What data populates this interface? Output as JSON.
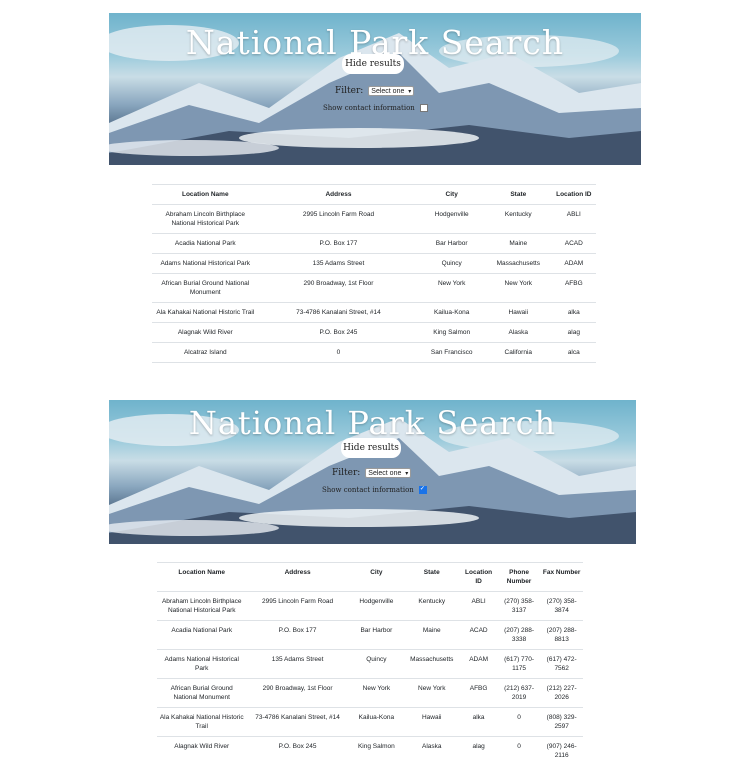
{
  "app": {
    "title": "National Park Search",
    "hide_button": "Hide results",
    "filter_label": "Filter:",
    "filter_selected": "Select one",
    "contact_label": "Show contact information"
  },
  "view1": {
    "contact_checked": false,
    "columns": [
      "Location Name",
      "Address",
      "City",
      "State",
      "Location ID"
    ],
    "rows": [
      [
        "Abraham Lincoln Birthplace National Historical Park",
        "2995 Lincoln Farm Road",
        "Hodgenville",
        "Kentucky",
        "ABLI"
      ],
      [
        "Acadia National Park",
        "P.O. Box 177",
        "Bar Harbor",
        "Maine",
        "ACAD"
      ],
      [
        "Adams National Historical Park",
        "135 Adams Street",
        "Quincy",
        "Massachusetts",
        "ADAM"
      ],
      [
        "African Burial Ground National Monument",
        "290 Broadway, 1st Floor",
        "New York",
        "New York",
        "AFBG"
      ],
      [
        "Ala Kahakai National Historic Trail",
        "73-4786 Kanalani Street, #14",
        "Kailua-Kona",
        "Hawaii",
        "alka"
      ],
      [
        "Alagnak Wild River",
        "P.O. Box 245",
        "King Salmon",
        "Alaska",
        "alag"
      ],
      [
        "Alcatraz Island",
        "0",
        "San Francisco",
        "California",
        "alca"
      ]
    ]
  },
  "view2": {
    "contact_checked": true,
    "columns": [
      "Location Name",
      "Address",
      "City",
      "State",
      "Location ID",
      "Phone Number",
      "Fax Number"
    ],
    "rows": [
      [
        "Abraham Lincoln Birthplace National Historical Park",
        "2995 Lincoln Farm Road",
        "Hodgenville",
        "Kentucky",
        "ABLI",
        "(270) 358-3137",
        "(270) 358-3874"
      ],
      [
        "Acadia National Park",
        "P.O. Box 177",
        "Bar Harbor",
        "Maine",
        "ACAD",
        "(207) 288-3338",
        "(207) 288-8813"
      ],
      [
        "Adams National Historical Park",
        "135 Adams Street",
        "Quincy",
        "Massachusetts",
        "ADAM",
        "(617) 770-1175",
        "(617) 472-7562"
      ],
      [
        "African Burial Ground National Monument",
        "290 Broadway, 1st Floor",
        "New York",
        "New York",
        "AFBG",
        "(212) 637-2019",
        "(212) 227-2026"
      ],
      [
        "Ala Kahakai National Historic Trail",
        "73-4786 Kanalani Street, #14",
        "Kailua-Kona",
        "Hawaii",
        "alka",
        "0",
        "(808) 329-2597"
      ],
      [
        "Alagnak Wild River",
        "P.O. Box 245",
        "King Salmon",
        "Alaska",
        "alag",
        "0",
        "(907) 246-2116"
      ]
    ]
  }
}
